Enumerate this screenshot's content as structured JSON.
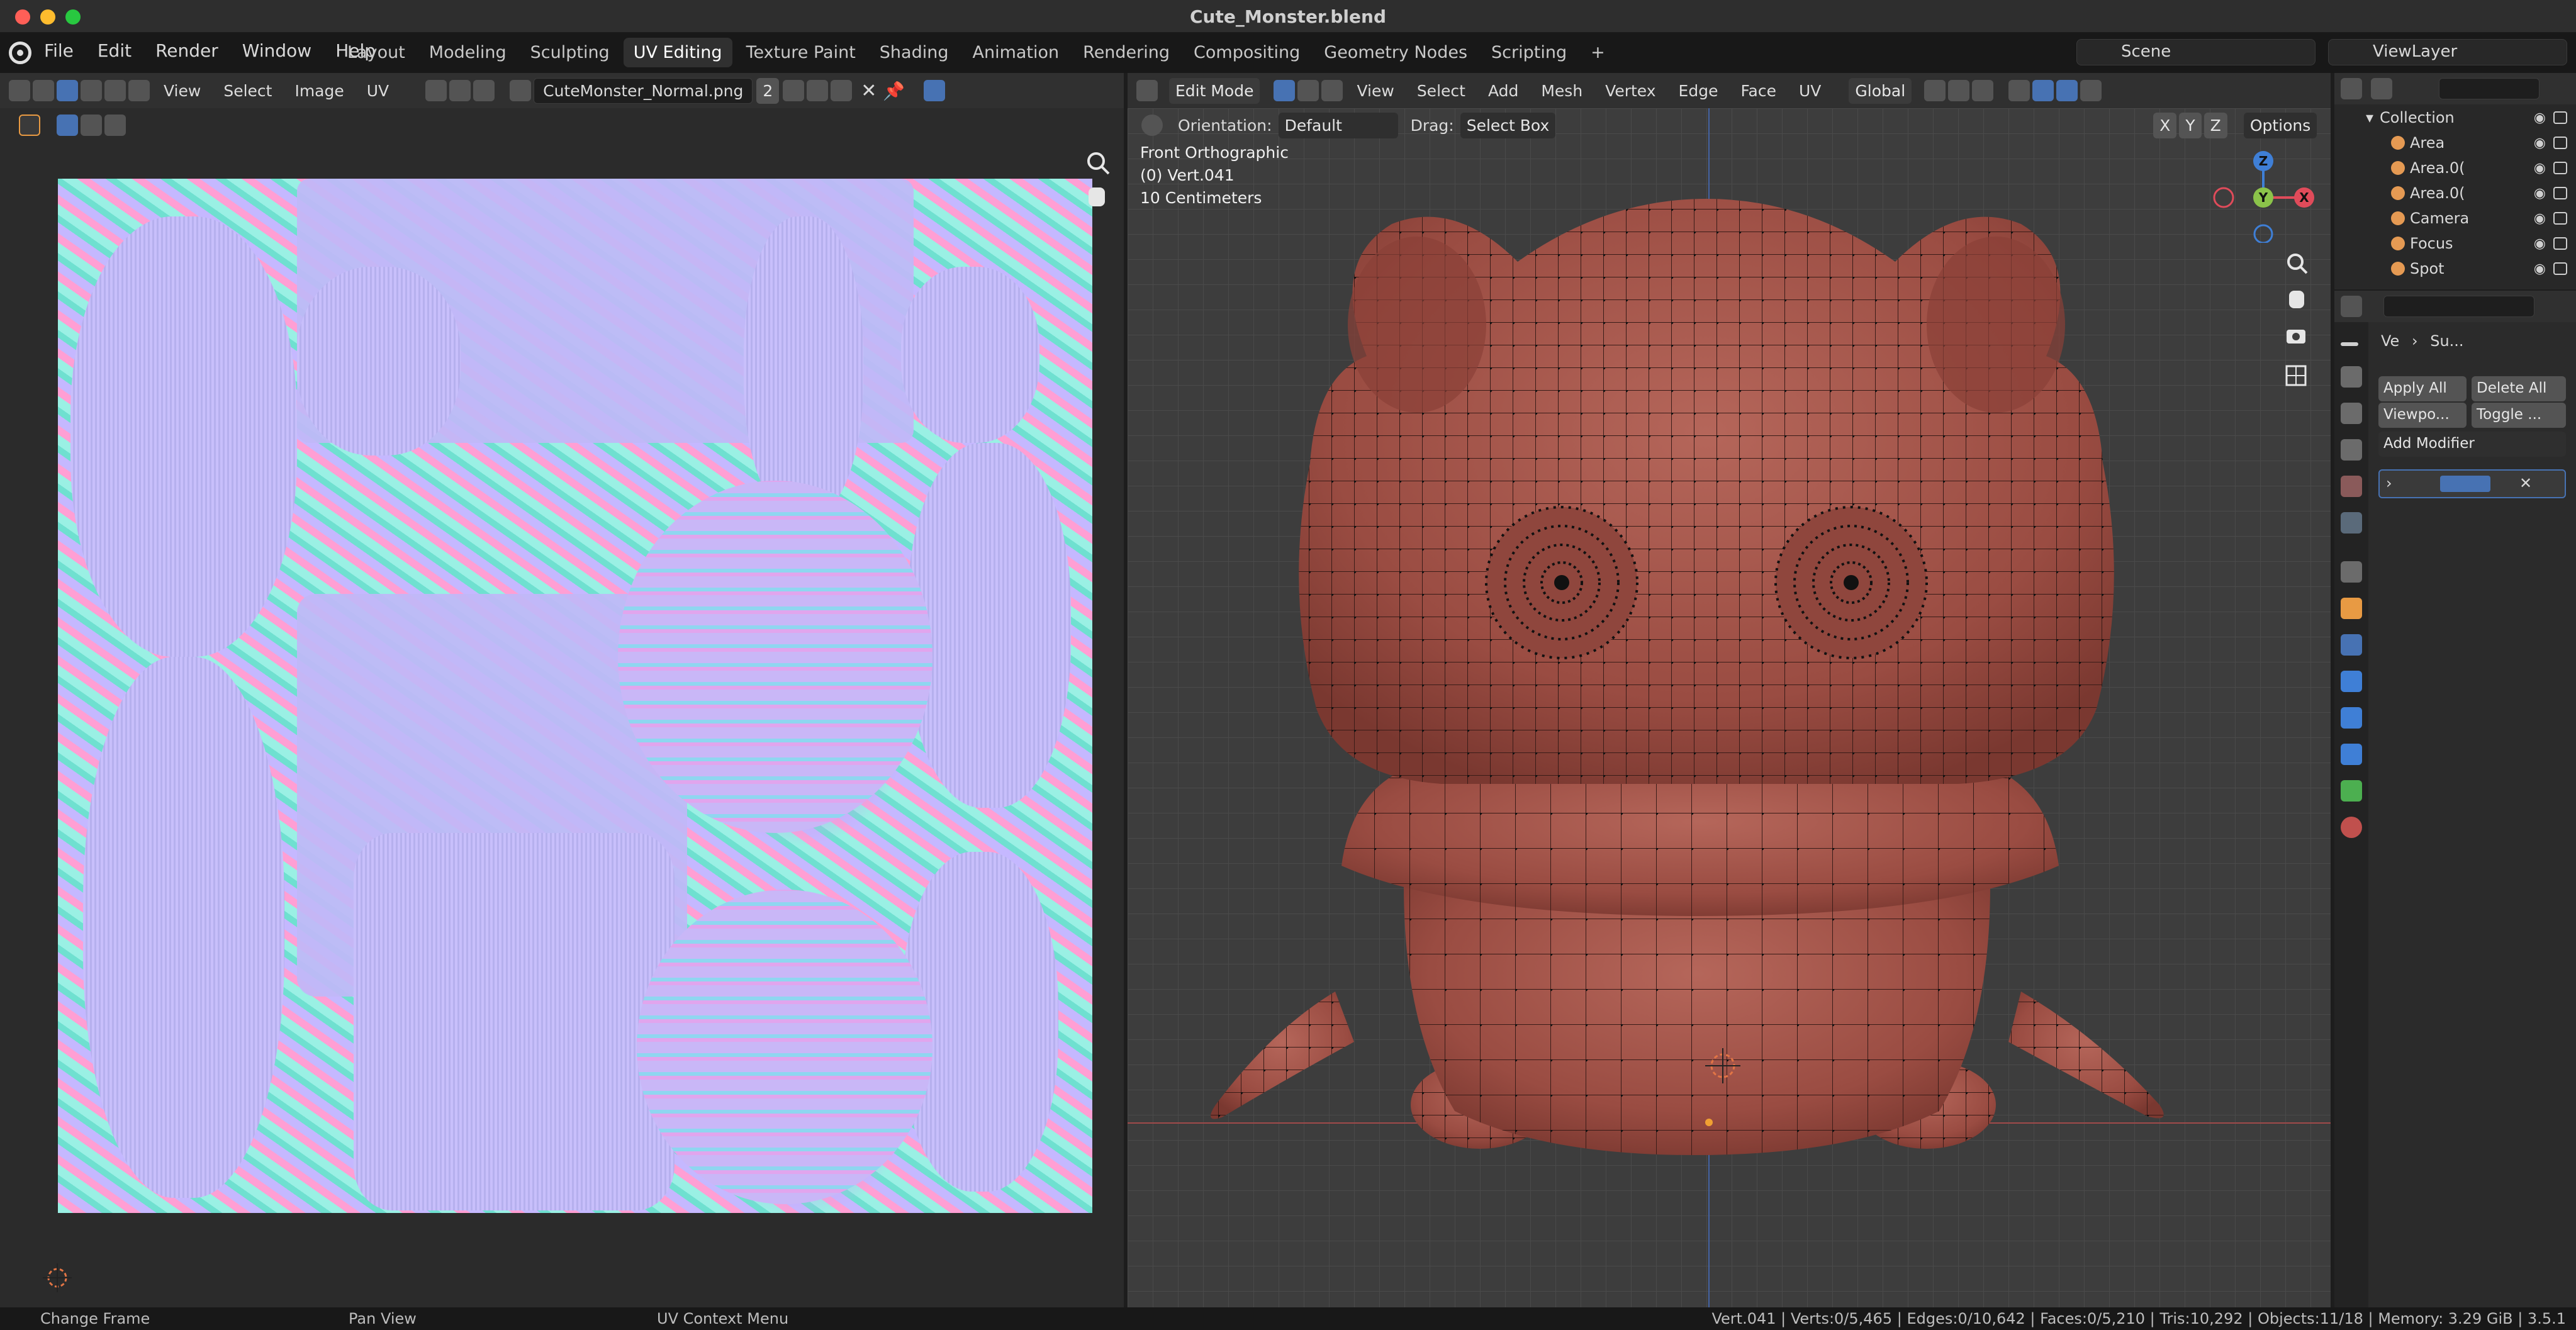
{
  "window": {
    "title": "Cute_Monster.blend"
  },
  "menu": [
    "File",
    "Edit",
    "Render",
    "Window",
    "Help"
  ],
  "workspaces": [
    {
      "label": "Layout",
      "active": false
    },
    {
      "label": "Modeling",
      "active": false
    },
    {
      "label": "Sculpting",
      "active": false
    },
    {
      "label": "UV Editing",
      "active": true
    },
    {
      "label": "Texture Paint",
      "active": false
    },
    {
      "label": "Shading",
      "active": false
    },
    {
      "label": "Animation",
      "active": false
    },
    {
      "label": "Rendering",
      "active": false
    },
    {
      "label": "Compositing",
      "active": false
    },
    {
      "label": "Geometry Nodes",
      "active": false
    },
    {
      "label": "Scripting",
      "active": false
    }
  ],
  "scene": "Scene",
  "view_layer": "ViewLayer",
  "uv_editor": {
    "menus": [
      "View",
      "Select",
      "Image",
      "UV"
    ],
    "image_name": "CuteMonster_Normal.png",
    "users": "2"
  },
  "viewport": {
    "mode": "Edit Mode",
    "menus": [
      "View",
      "Select",
      "Add",
      "Mesh",
      "Vertex",
      "Edge",
      "Face",
      "UV"
    ],
    "transform": "Global",
    "orientation_label": "Orientation:",
    "orientation_value": "Default",
    "drag_label": "Drag:",
    "drag_value": "Select Box",
    "axes": [
      "X",
      "Y",
      "Z"
    ],
    "options": "Options",
    "overlay_view": "Front Orthographic",
    "overlay_object": "(0) Vert.041",
    "overlay_scale": "10 Centimeters",
    "gizmo": {
      "z": "Z",
      "y": "Y",
      "x": "X"
    }
  },
  "outliner": {
    "root": "Collection",
    "items": [
      "Area",
      "Area.0(",
      "Area.0(",
      "Camera",
      "Focus",
      "Spot"
    ]
  },
  "properties": {
    "breadcrumb_obj": "Ve",
    "breadcrumb_mod": "Su...",
    "apply_all": "Apply All",
    "delete_all": "Delete All",
    "viewport_btn": "Viewpo...",
    "toggle_btn": "Toggle ...",
    "add_modifier": "Add Modifier"
  },
  "status": {
    "left": "Change Frame",
    "mid": "Pan View",
    "right": "UV Context Menu",
    "stats": "Vert.041 | Verts:0/5,465 | Edges:0/10,642 | Faces:0/5,210 | Tris:10,292 | Objects:11/18 | Memory: 3.29 GiB | 3.5.1"
  },
  "colors": {
    "accent": "#4772b3",
    "active_orange": "#e89a43",
    "axis_x": "#e04b5a",
    "axis_y": "#8bc34a",
    "axis_z": "#3f7fd6",
    "mesh": "#a8584d"
  }
}
